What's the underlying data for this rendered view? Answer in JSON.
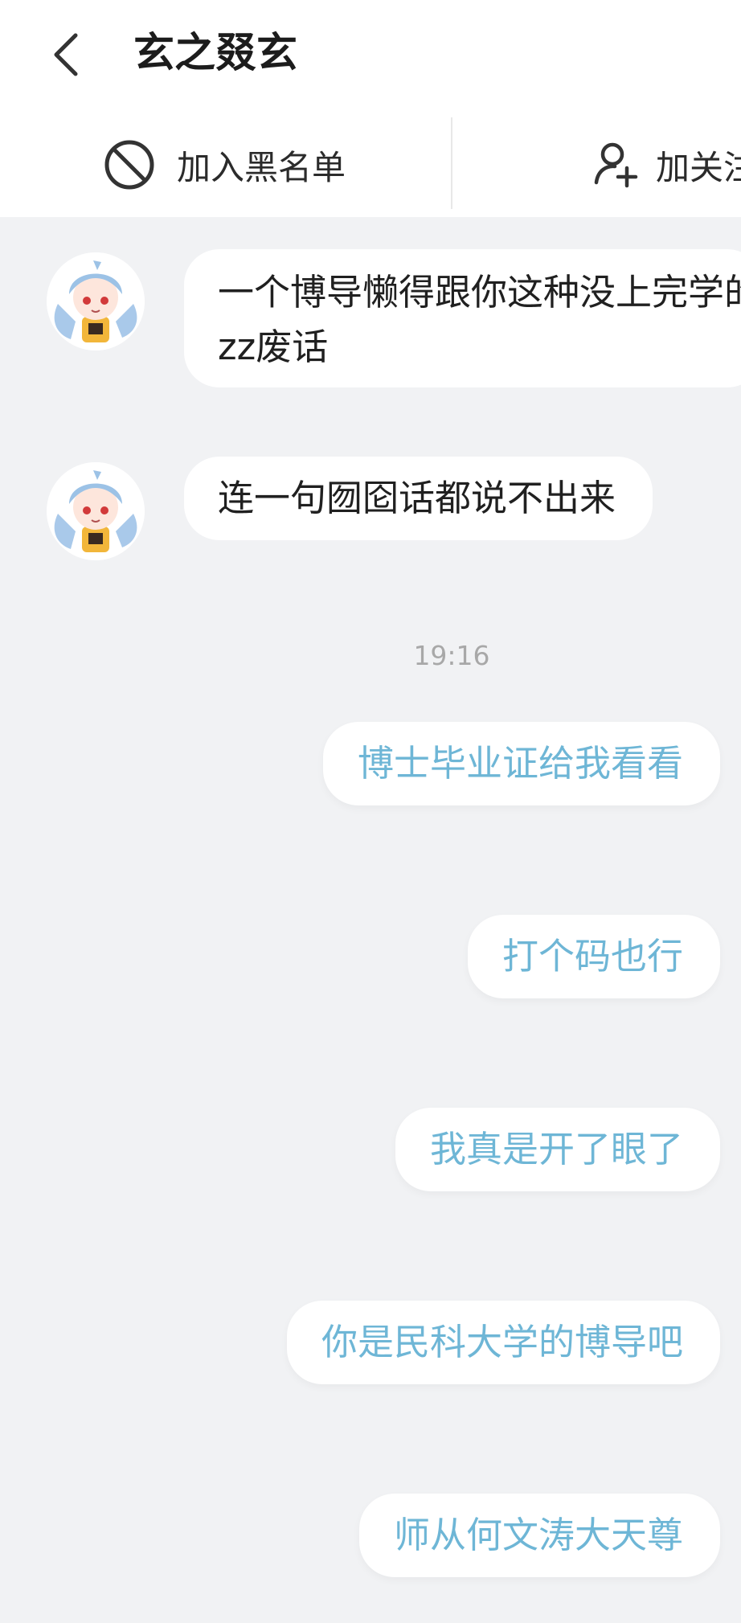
{
  "header": {
    "title": "玄之叕玄",
    "back_icon": "chevron-left-icon"
  },
  "actions": {
    "block_label": "加入黑名单",
    "block_icon": "block-icon",
    "follow_label": "加关注",
    "follow_icon": "add-person-icon"
  },
  "messages": {
    "incoming": [
      {
        "text": "一个博导懒得跟你这种没上完学的zz废话"
      },
      {
        "text": "连一句囫囵话都说不出来"
      }
    ],
    "timestamp": "19:16",
    "outgoing": [
      {
        "text": "博士毕业证给我看看"
      },
      {
        "text": "打个码也行"
      },
      {
        "text": "我真是开了眼了"
      },
      {
        "text": "你是民科大学的博导吧"
      },
      {
        "text": "师从何文涛大天尊"
      }
    ]
  },
  "colors": {
    "background": "#f1f2f4",
    "outgoing_text": "#6eb6d6",
    "incoming_text": "#202020",
    "avatar_hair": "#9cc2e6",
    "avatar_shirt": "#f2b63a"
  }
}
